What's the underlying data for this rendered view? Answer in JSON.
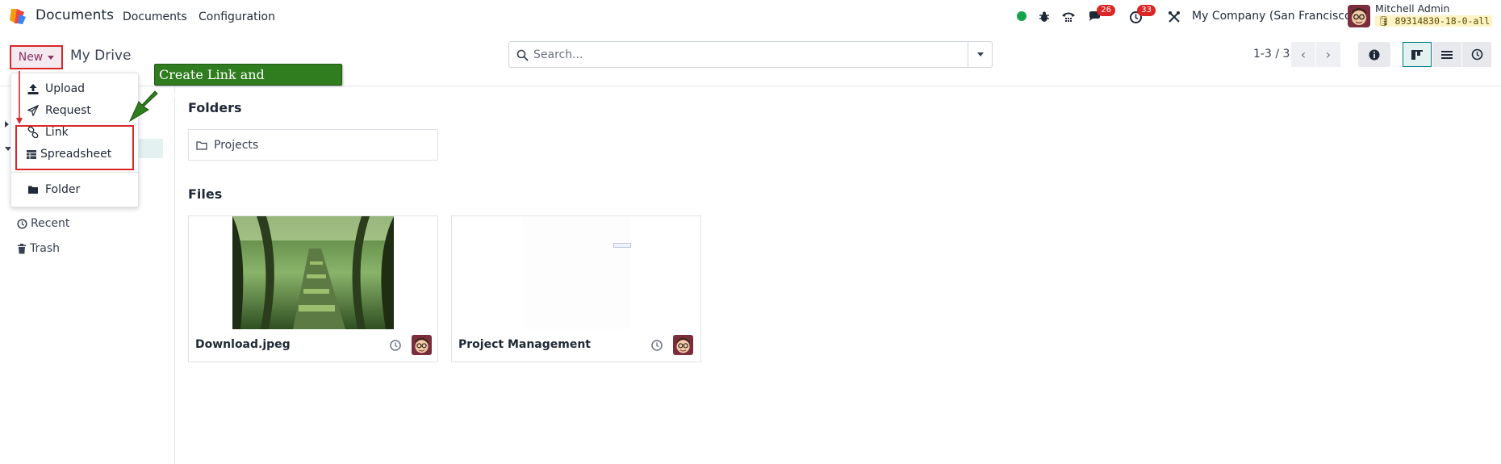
{
  "app": {
    "name": "Documents"
  },
  "nav": {
    "menu_documents": "Documents",
    "menu_configuration": "Configuration"
  },
  "systray": {
    "messages_count": "26",
    "activities_count": "33",
    "company": "My Company (San Francisco)",
    "user_name": "Mitchell Admin",
    "database": "89314830-18-0-all",
    "icons": [
      "status-dot",
      "bug-icon",
      "phone-icon",
      "chat-icon",
      "clock-icon",
      "tools-icon"
    ]
  },
  "control": {
    "new_label": "New",
    "breadcrumb": "My Drive",
    "search_placeholder": "Search...",
    "pager": "1-3 / 3"
  },
  "dropdown": {
    "upload": "Upload",
    "request": "Request",
    "link": "Link",
    "spreadsheet": "Spreadsheet",
    "folder": "Folder"
  },
  "annotation": {
    "callout": "Create Link and Spreadsheet"
  },
  "sidebar": {
    "recent": "Recent",
    "trash": "Trash"
  },
  "main": {
    "folders_title": "Folders",
    "files_title": "Files",
    "folders": [
      {
        "name": "Projects"
      }
    ],
    "files": [
      {
        "name": "Download.jpeg"
      },
      {
        "name": "Project Management"
      }
    ]
  },
  "colors": {
    "brand": "#714B67",
    "accent": "#017e84",
    "highlight_red": "#d92626",
    "callout_green": "#2f7d1e"
  }
}
